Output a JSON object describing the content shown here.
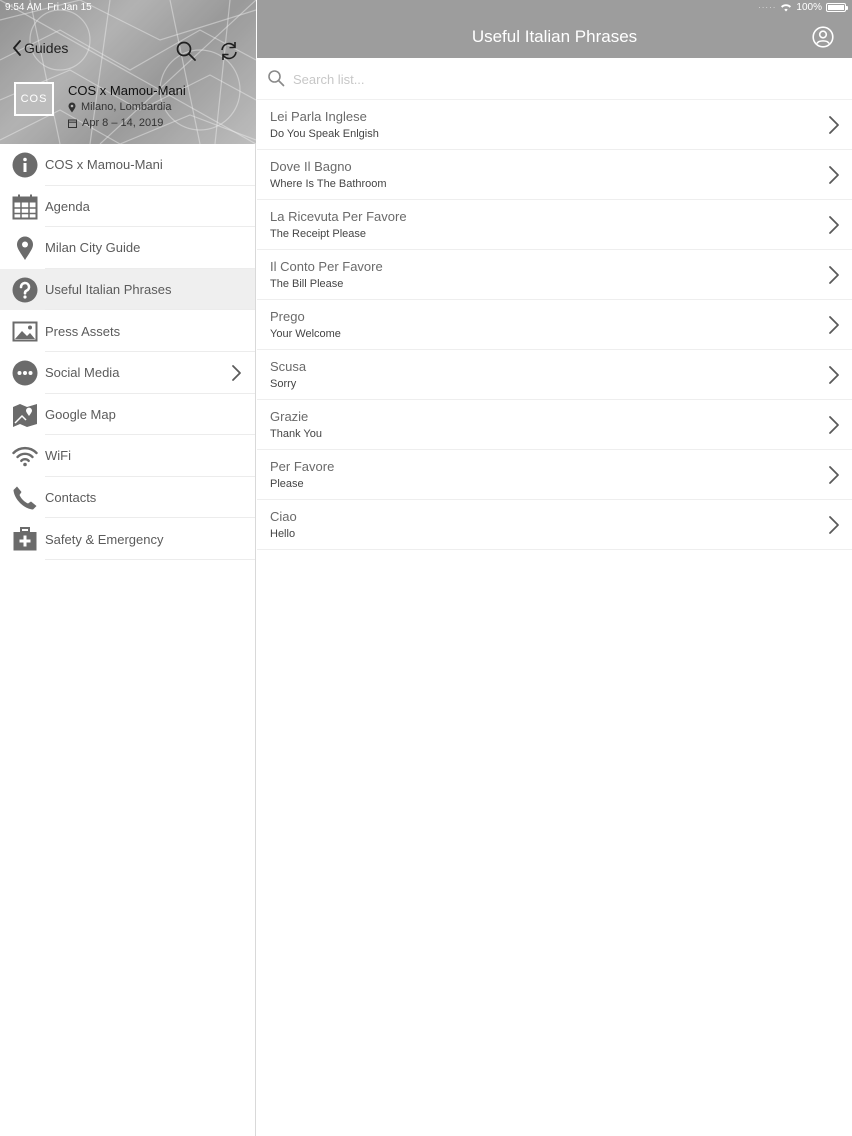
{
  "status": {
    "time": "9:54 AM",
    "date": "Fri Jan 15",
    "battery": "100%",
    "battery_level": 1.0
  },
  "sidebar": {
    "back_label": "Guides",
    "event": {
      "logo_text": "COS",
      "title": "COS x Mamou-Mani",
      "location": "Milano, Lombardia",
      "dates": "Apr 8 – 14, 2019"
    },
    "items": [
      {
        "label": "COS x Mamou-Mani",
        "icon": "info-icon"
      },
      {
        "label": "Agenda",
        "icon": "calendar-icon"
      },
      {
        "label": "Milan City Guide",
        "icon": "map-pin-icon"
      },
      {
        "label": "Useful Italian Phrases",
        "icon": "question-icon",
        "active": true
      },
      {
        "label": "Press Assets",
        "icon": "image-icon"
      },
      {
        "label": "Social Media",
        "icon": "more-dots-icon",
        "has_submenu": true
      },
      {
        "label": "Google Map",
        "icon": "map-icon"
      },
      {
        "label": "WiFi",
        "icon": "wifi-icon"
      },
      {
        "label": "Contacts",
        "icon": "phone-icon"
      },
      {
        "label": "Safety & Emergency",
        "icon": "first-aid-icon"
      }
    ]
  },
  "main": {
    "title": "Useful Italian Phrases",
    "search_placeholder": "Search list...",
    "phrases": [
      {
        "italian": "Lei Parla Inglese",
        "english": "Do You Speak Enlgish"
      },
      {
        "italian": "Dove Il Bagno",
        "english": "Where Is The Bathroom"
      },
      {
        "italian": "La Ricevuta Per Favore",
        "english": "The Receipt Please"
      },
      {
        "italian": "Il Conto Per Favore",
        "english": "The Bill Please"
      },
      {
        "italian": "Prego",
        "english": "Your Welcome"
      },
      {
        "italian": "Scusa",
        "english": "Sorry"
      },
      {
        "italian": "Grazie",
        "english": "Thank You"
      },
      {
        "italian": "Per Favore",
        "english": "Please"
      },
      {
        "italian": "Ciao",
        "english": "Hello"
      }
    ]
  },
  "colors": {
    "top_bar": "#9d9d9d",
    "active_row": "#efefef",
    "icon": "#6b6b6b"
  }
}
